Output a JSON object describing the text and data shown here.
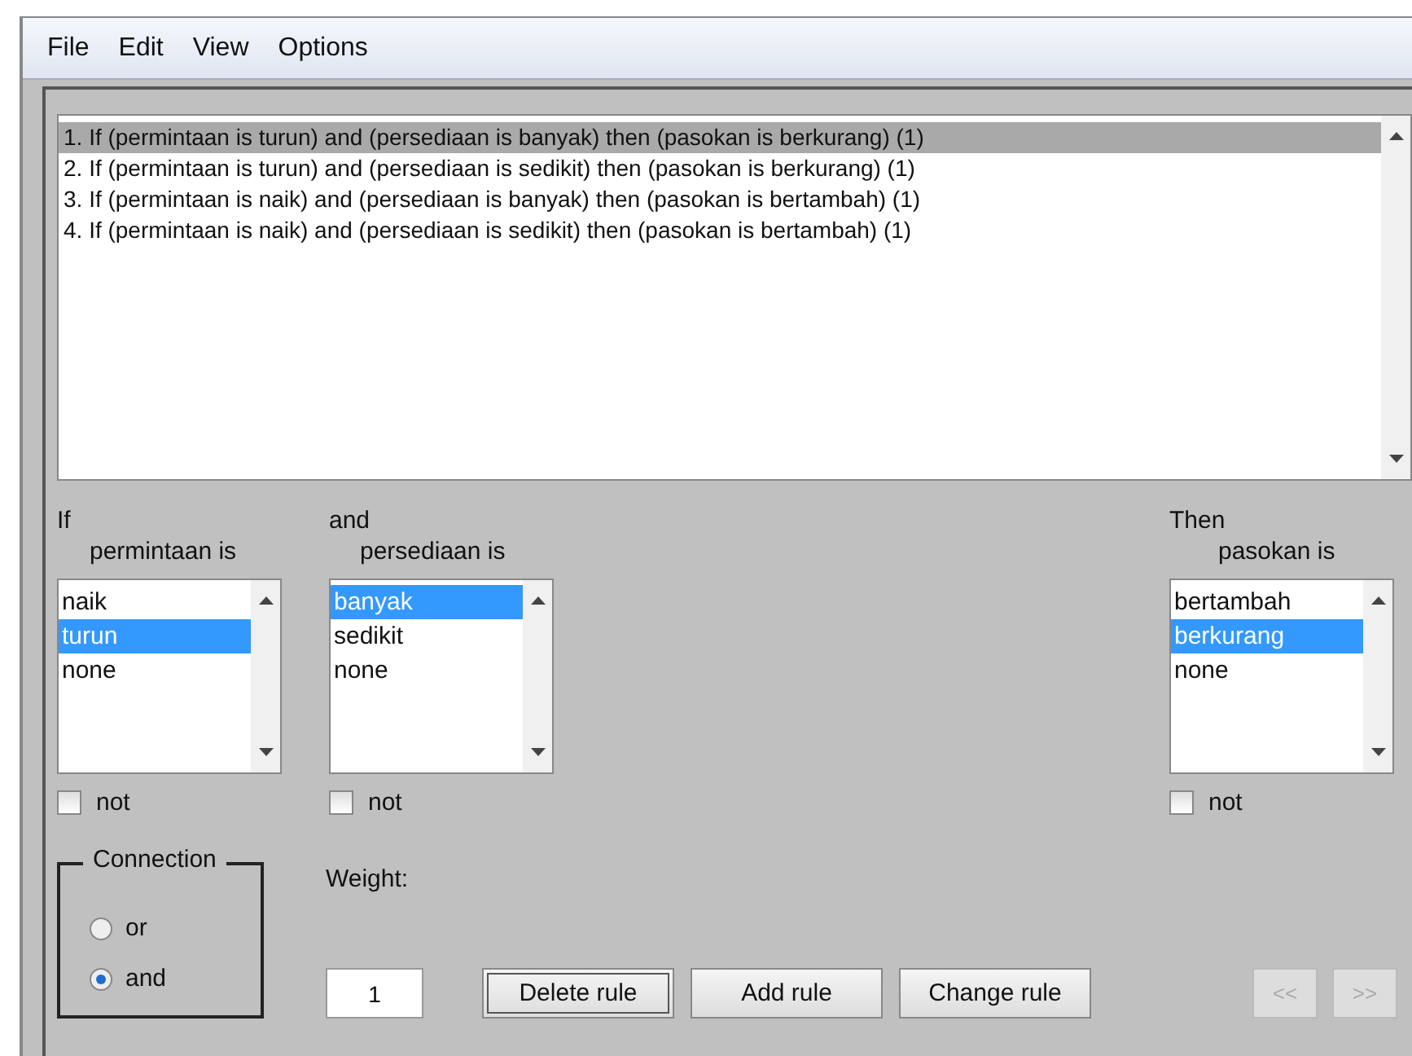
{
  "menu": [
    "File",
    "Edit",
    "View",
    "Options"
  ],
  "rules": [
    {
      "text": "1. If (permintaan is turun) and (persediaan is banyak) then (pasokan is berkurang) (1)",
      "selected": true
    },
    {
      "text": "2. If (permintaan is turun) and (persediaan is sedikit) then (pasokan is berkurang) (1)",
      "selected": false
    },
    {
      "text": "3. If (permintaan is naik) and (persediaan is banyak) then (pasokan is bertambah) (1)",
      "selected": false
    },
    {
      "text": "4. If (permintaan is naik) and (persediaan is sedikit) then (pasokan is bertambah) (1)",
      "selected": false
    }
  ],
  "variables": [
    {
      "heading": "If",
      "label": "permintaan is",
      "options": [
        {
          "text": "naik",
          "selected": false
        },
        {
          "text": "turun",
          "selected": true
        },
        {
          "text": "none",
          "selected": false
        }
      ],
      "not": {
        "label": "not",
        "checked": false
      }
    },
    {
      "heading": "and",
      "label": "persediaan is",
      "options": [
        {
          "text": "banyak",
          "selected": true
        },
        {
          "text": "sedikit",
          "selected": false
        },
        {
          "text": "none",
          "selected": false
        }
      ],
      "not": {
        "label": "not",
        "checked": false
      }
    },
    {
      "heading": "Then",
      "label": "pasokan is",
      "options": [
        {
          "text": "bertambah",
          "selected": false
        },
        {
          "text": "berkurang",
          "selected": true
        },
        {
          "text": "none",
          "selected": false
        }
      ],
      "not": {
        "label": "not",
        "checked": false
      }
    }
  ],
  "connection": {
    "title": "Connection",
    "options": [
      {
        "label": "or",
        "selected": false
      },
      {
        "label": "and",
        "selected": true
      }
    ]
  },
  "weight": {
    "label": "Weight:",
    "value": "1"
  },
  "buttons": [
    {
      "label": "Delete rule",
      "focused": true
    },
    {
      "label": "Add rule",
      "focused": false
    },
    {
      "label": "Change rule",
      "focused": false
    }
  ],
  "nav_buttons": [
    {
      "label": "<<",
      "disabled": true
    },
    {
      "label": ">>",
      "disabled": true
    }
  ]
}
